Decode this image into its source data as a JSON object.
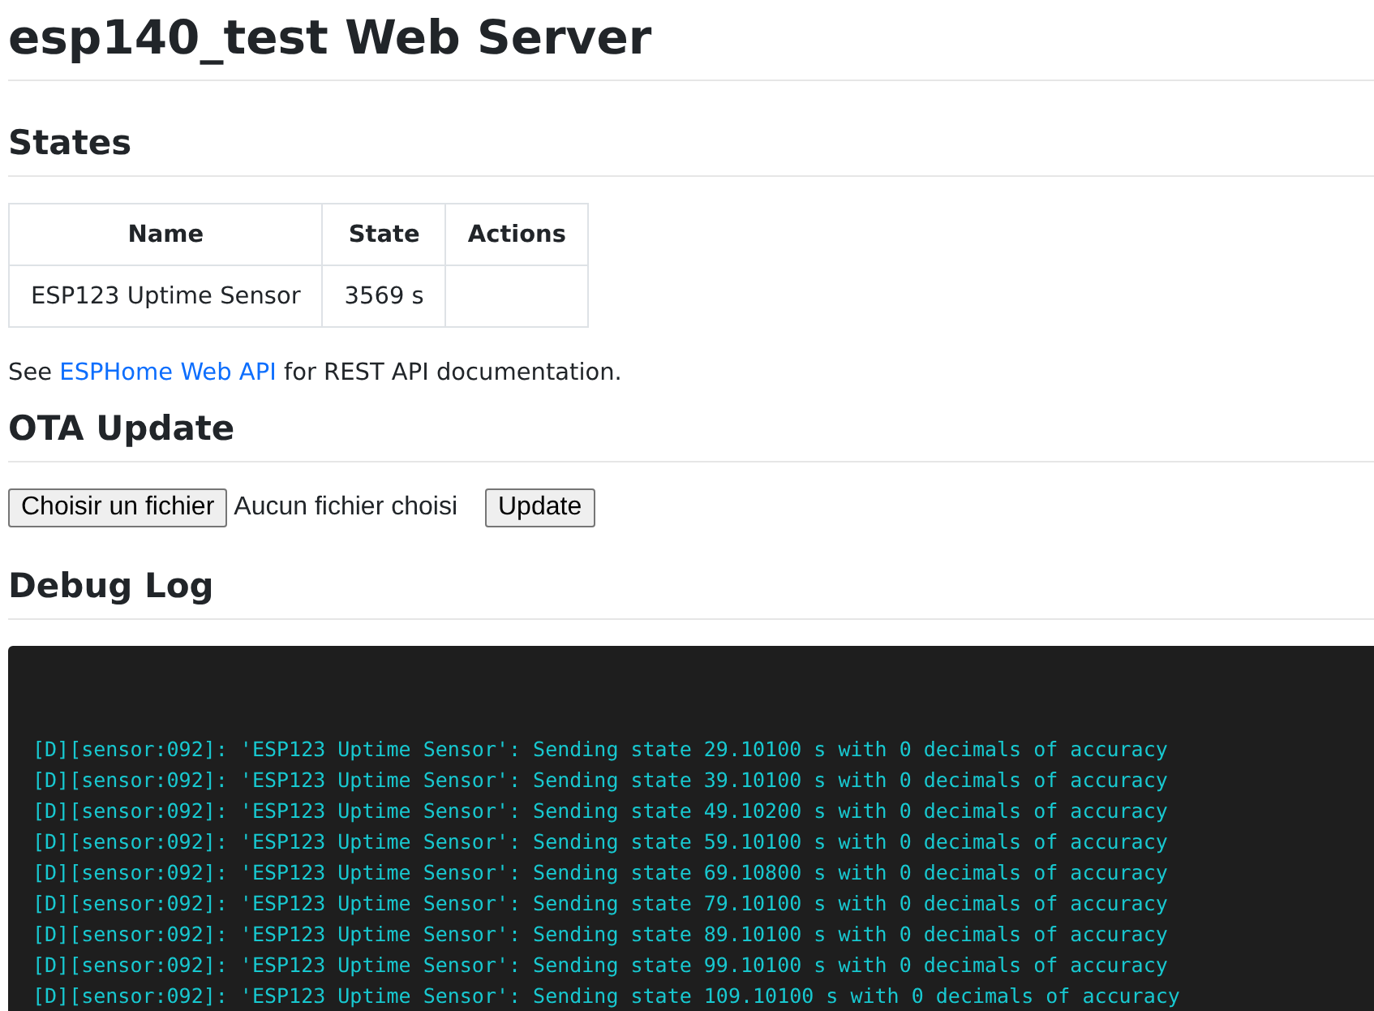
{
  "title": "esp140_test Web Server",
  "states": {
    "heading": "States",
    "table": {
      "columns": [
        "Name",
        "State",
        "Actions"
      ],
      "rows": [
        {
          "cells": [
            "ESP123 Uptime Sensor",
            "3569 s",
            ""
          ]
        }
      ]
    },
    "note": {
      "before": "See ",
      "link": "ESPHome Web API",
      "after": " for REST API documentation."
    }
  },
  "ota": {
    "heading": "OTA Update",
    "file_button": "Choisir un fichier",
    "file_status": "Aucun fichier choisi",
    "update_button": "Update"
  },
  "debug": {
    "heading": "Debug Log",
    "lines": [
      "[D][sensor:092]: 'ESP123 Uptime Sensor': Sending state 29.10100 s with 0 decimals of accuracy",
      "[D][sensor:092]: 'ESP123 Uptime Sensor': Sending state 39.10100 s with 0 decimals of accuracy",
      "[D][sensor:092]: 'ESP123 Uptime Sensor': Sending state 49.10200 s with 0 decimals of accuracy",
      "[D][sensor:092]: 'ESP123 Uptime Sensor': Sending state 59.10100 s with 0 decimals of accuracy",
      "[D][sensor:092]: 'ESP123 Uptime Sensor': Sending state 69.10800 s with 0 decimals of accuracy",
      "[D][sensor:092]: 'ESP123 Uptime Sensor': Sending state 79.10100 s with 0 decimals of accuracy",
      "[D][sensor:092]: 'ESP123 Uptime Sensor': Sending state 89.10100 s with 0 decimals of accuracy",
      "[D][sensor:092]: 'ESP123 Uptime Sensor': Sending state 99.10100 s with 0 decimals of accuracy",
      "[D][sensor:092]: 'ESP123 Uptime Sensor': Sending state 109.10100 s with 0 decimals of accuracy"
    ]
  }
}
